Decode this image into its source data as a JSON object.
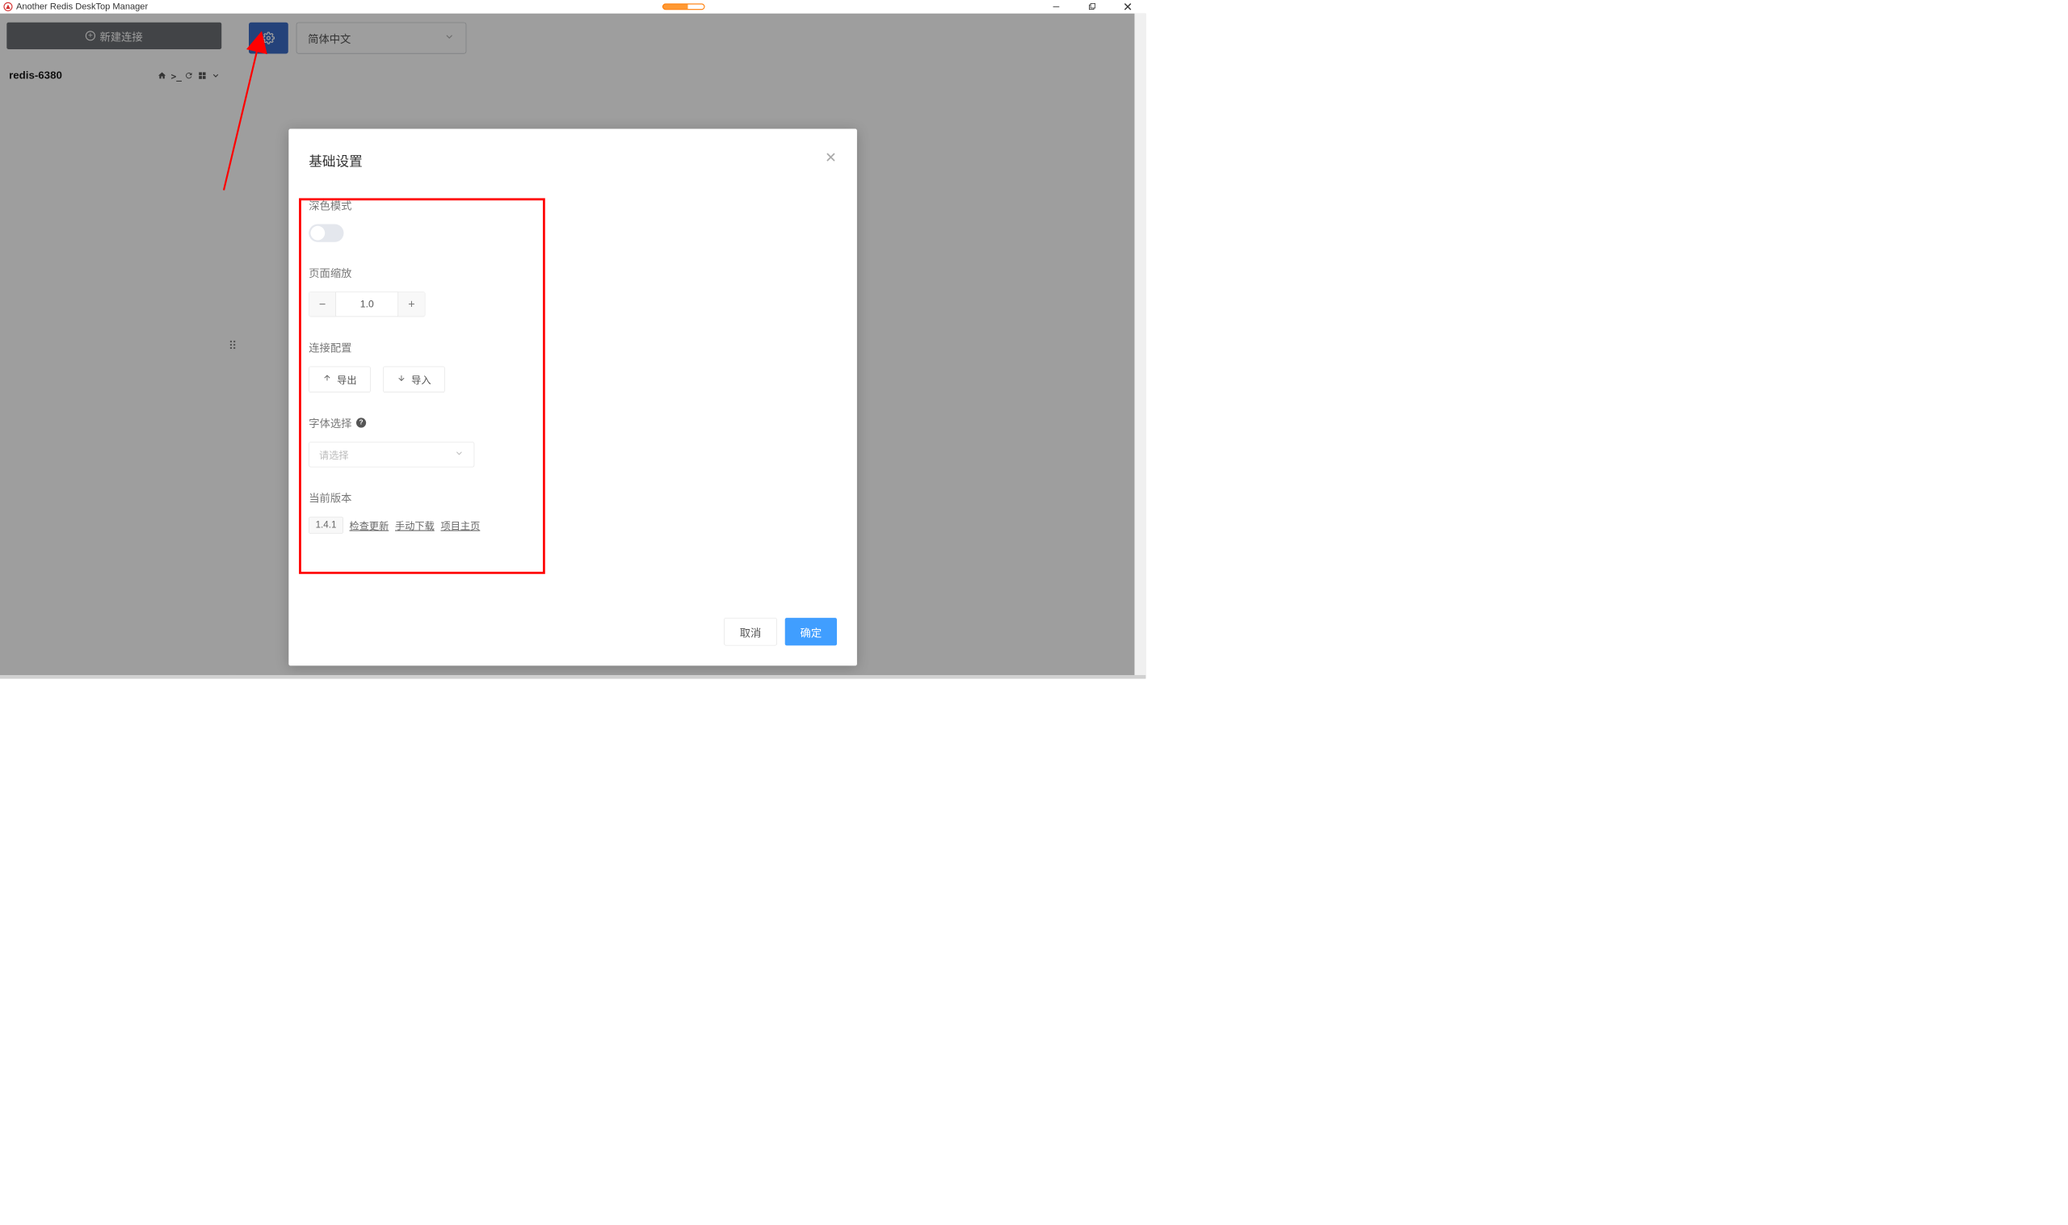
{
  "app": {
    "title": "Another Redis DeskTop Manager"
  },
  "sidebar": {
    "new_connection_label": "新建连接",
    "connections": [
      {
        "name": "redis-6380"
      }
    ]
  },
  "toolbar": {
    "language_value": "简体中文"
  },
  "dialog": {
    "title": "基础设置",
    "sections": {
      "dark_mode": {
        "label": "深色模式",
        "value": false
      },
      "page_zoom": {
        "label": "页面缩放",
        "value": "1.0"
      },
      "conn_config": {
        "label": "连接配置",
        "export_label": "导出",
        "import_label": "导入"
      },
      "font_family": {
        "label": "字体选择",
        "placeholder": "请选择"
      },
      "version": {
        "label": "当前版本",
        "badge": "1.4.1",
        "links": {
          "check_update": "检查更新",
          "manual_download": "手动下载",
          "project_home": "项目主页"
        }
      }
    },
    "footer": {
      "cancel": "取消",
      "confirm": "确定"
    }
  }
}
